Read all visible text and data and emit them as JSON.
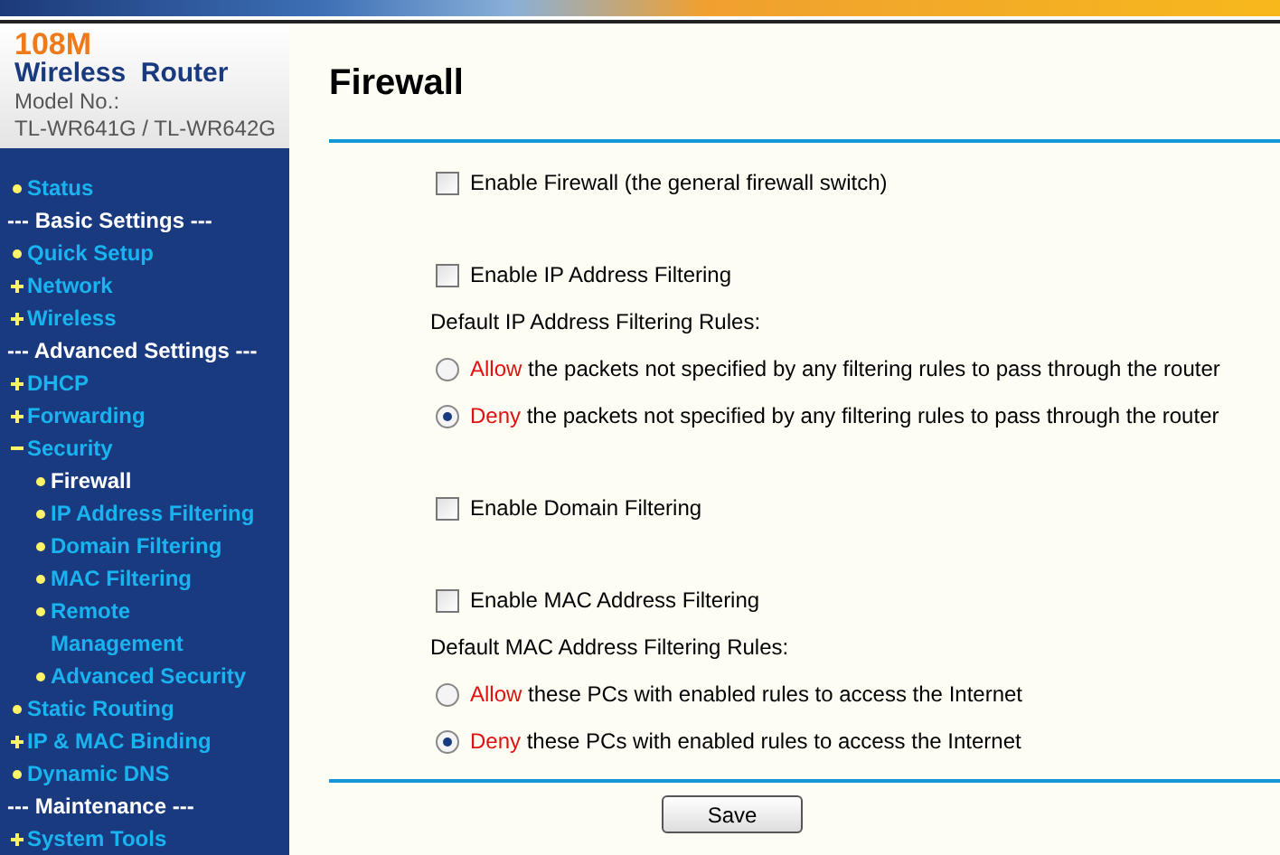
{
  "logo": {
    "speed": "108M",
    "product": "Wireless  Router",
    "model_label": "Model No.:",
    "model": "TL-WR641G / TL-WR642G"
  },
  "sidebar": {
    "items": [
      {
        "kind": "bullet",
        "label": "Status",
        "selected": false
      },
      {
        "kind": "heading",
        "label": "--- Basic Settings ---"
      },
      {
        "kind": "bullet",
        "label": "Quick Setup",
        "selected": false
      },
      {
        "kind": "plus",
        "label": "Network",
        "selected": false
      },
      {
        "kind": "plus",
        "label": "Wireless",
        "selected": false
      },
      {
        "kind": "heading",
        "label": "--- Advanced Settings ---"
      },
      {
        "kind": "plus",
        "label": "DHCP",
        "selected": false
      },
      {
        "kind": "plus",
        "label": "Forwarding",
        "selected": false
      },
      {
        "kind": "minus",
        "label": "Security",
        "selected": false,
        "children": [
          {
            "kind": "bullet",
            "label": "Firewall",
            "selected": true
          },
          {
            "kind": "bullet",
            "label": "IP Address Filtering",
            "selected": false
          },
          {
            "kind": "bullet",
            "label": "Domain Filtering",
            "selected": false
          },
          {
            "kind": "bullet",
            "label": "MAC Filtering",
            "selected": false
          },
          {
            "kind": "bullet",
            "label": "Remote Management",
            "selected": false
          },
          {
            "kind": "bullet",
            "label": "Advanced Security",
            "selected": false
          }
        ]
      },
      {
        "kind": "bullet",
        "label": "Static Routing",
        "selected": false
      },
      {
        "kind": "plus",
        "label": "IP & MAC Binding",
        "selected": false
      },
      {
        "kind": "bullet",
        "label": "Dynamic DNS",
        "selected": false
      },
      {
        "kind": "heading",
        "label": "--- Maintenance ---"
      },
      {
        "kind": "plus",
        "label": "System Tools",
        "selected": false
      }
    ]
  },
  "page": {
    "title": "Firewall",
    "sections": [
      {
        "checkbox": {
          "label": "Enable Firewall (the general firewall switch)",
          "checked": false
        }
      },
      {
        "checkbox": {
          "label": "Enable IP Address Filtering",
          "checked": false
        },
        "rules_label": "Default IP Address Filtering Rules:",
        "rules": [
          {
            "keyword": "Allow",
            "text": " the packets not specified by any filtering rules to pass through the router",
            "selected": false
          },
          {
            "keyword": "Deny",
            "text": " the packets not specified by any filtering rules to pass through the router",
            "selected": true
          }
        ]
      },
      {
        "checkbox": {
          "label": "Enable Domain Filtering",
          "checked": false
        }
      },
      {
        "checkbox": {
          "label": "Enable MAC Address Filtering",
          "checked": false
        },
        "rules_label": "Default MAC Address Filtering Rules:",
        "rules": [
          {
            "keyword": "Allow",
            "text": " these PCs with enabled rules to access the Internet",
            "selected": false
          },
          {
            "keyword": "Deny",
            "text": " these PCs with enabled rules to access the Internet",
            "selected": true
          }
        ]
      }
    ],
    "save_button": "Save"
  }
}
